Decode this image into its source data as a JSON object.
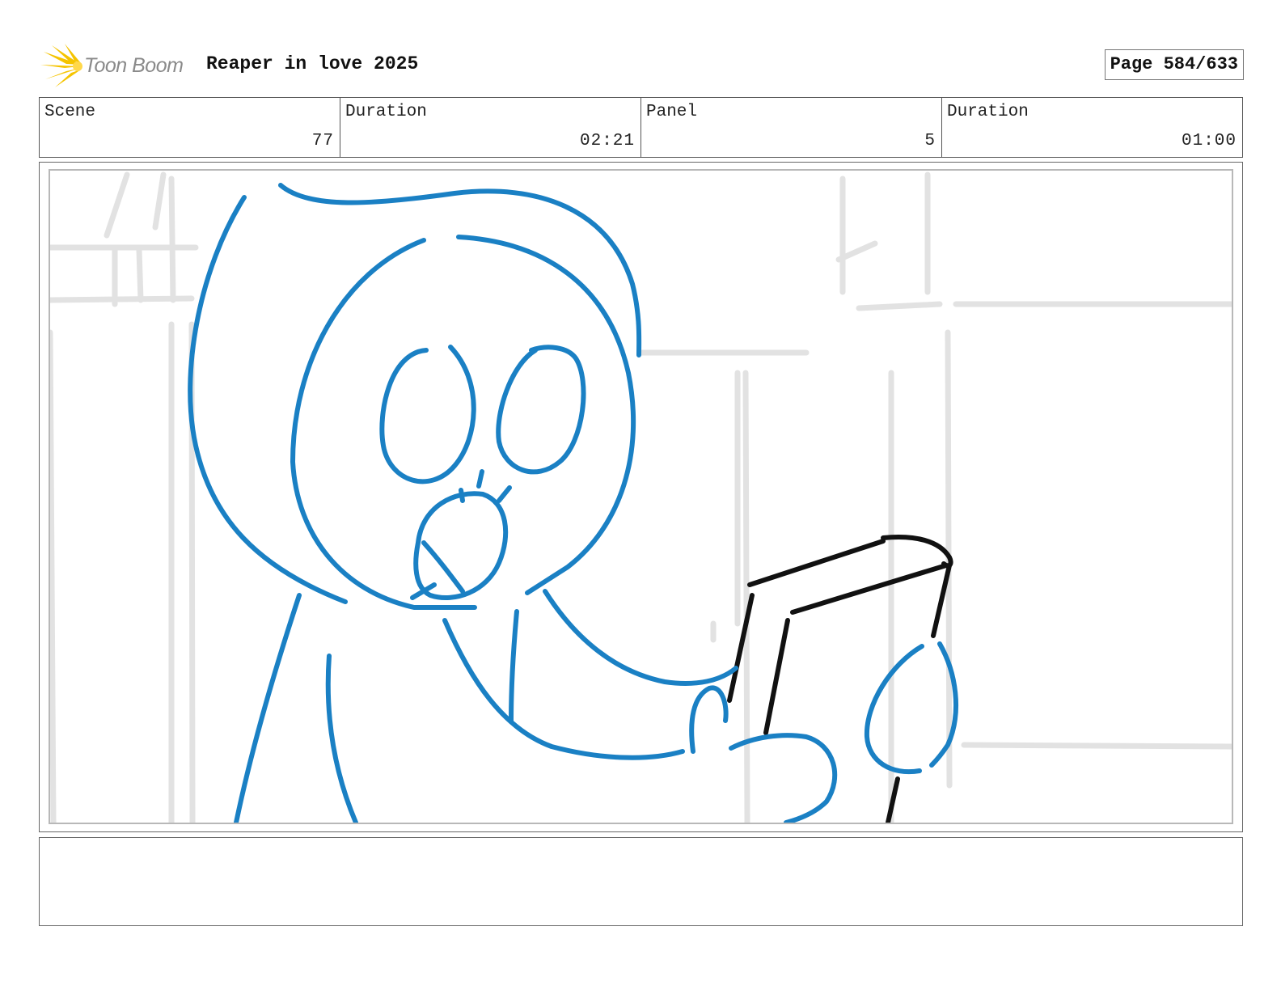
{
  "header": {
    "logo_text": "Toon Boom",
    "logo_icon": "starburst-icon",
    "project_title": "Reaper in love 2025",
    "page_label": "Page 584/633"
  },
  "info": {
    "scene_label": "Scene",
    "scene_value": "77",
    "scene_duration_label": "Duration",
    "scene_duration_value": "02:21",
    "panel_label": "Panel",
    "panel_value": "5",
    "panel_duration_label": "Duration",
    "panel_duration_value": "01:00"
  },
  "colors": {
    "character_stroke": "#1a80c4",
    "prop_stroke": "#111111",
    "background_sketch": "#e2e2e2",
    "logo_yellow": "#f5c400"
  }
}
